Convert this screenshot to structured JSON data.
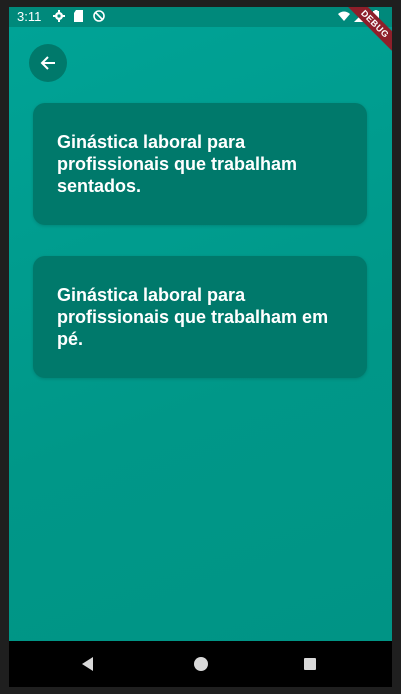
{
  "status_bar": {
    "time": "3:11",
    "icons_left": [
      "gear-icon",
      "sd-card-icon",
      "no-disturb-icon"
    ],
    "icons_right": [
      "wifi-icon",
      "signal-icon",
      "battery-icon"
    ]
  },
  "debug_banner": {
    "label": "DEBUG"
  },
  "app": {
    "back_icon": "arrow-left-icon",
    "cards": [
      {
        "title": "Ginástica laboral para profissionais que trabalham sentados."
      },
      {
        "title": "Ginástica laboral para profissionais que trabalham em pé."
      }
    ]
  },
  "nav_bar": {
    "buttons": [
      "back-triangle-icon",
      "home-circle-icon",
      "recents-square-icon"
    ]
  },
  "colors": {
    "status_bar": "#00897b",
    "background": "#009788",
    "card": "#00796b",
    "back_button": "#00796b",
    "debug_ribbon": "#8e1f2a",
    "text": "#ffffff"
  }
}
